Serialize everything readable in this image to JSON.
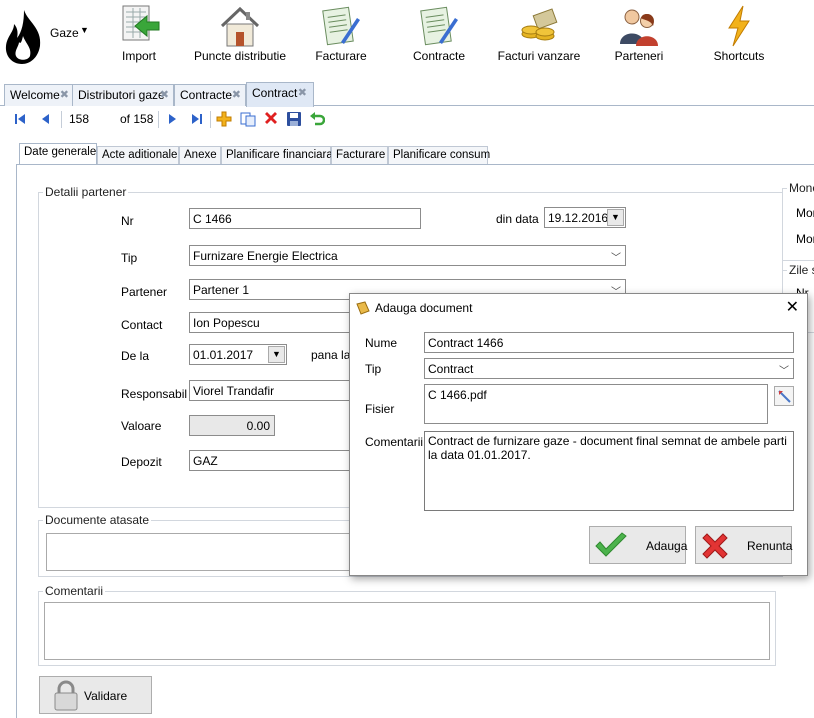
{
  "app": {
    "title": "Gaze"
  },
  "ribbon": [
    {
      "name": "import-button",
      "icon": "import-icon",
      "label": "Import"
    },
    {
      "name": "puncte-distributie-button",
      "icon": "house-icon",
      "label": "Puncte distributie"
    },
    {
      "name": "facturare-button",
      "icon": "invoice-icon",
      "label": "Facturare"
    },
    {
      "name": "contracte-button",
      "icon": "contract-icon",
      "label": "Contracte"
    },
    {
      "name": "facturi-vanzare-button",
      "icon": "coins-icon",
      "label": "Facturi vanzare"
    },
    {
      "name": "parteneri-button",
      "icon": "people-icon",
      "label": "Parteneri"
    },
    {
      "name": "shortcuts-button",
      "icon": "lightning-icon",
      "label": "Shortcuts"
    }
  ],
  "doc_tabs": [
    "Welcome",
    "Distributori gaze",
    "Contracte",
    "Contract"
  ],
  "navigator": {
    "current": "158",
    "of_total": "of 158"
  },
  "inner_tabs": [
    "Date generale",
    "Acte aditionale",
    "Anexe",
    "Planificare financiara",
    "Facturare",
    "Planificare consum"
  ],
  "detalii": {
    "legend": "Detalii partener",
    "nr_label": "Nr",
    "nr_value": "C 1466",
    "din_data_label": "din data",
    "din_data_value": "19.12.2016",
    "tip_label": "Tip",
    "tip_value": "Furnizare Energie Electrica",
    "partener_label": "Partener",
    "partener_value": "Partener 1",
    "contact_label": "Contact",
    "contact_value": "Ion Popescu",
    "de_la_label": "De la",
    "de_la_value": "01.01.2017",
    "pana_la_label": "pana la",
    "responsabil_label": "Responsabil",
    "responsabil_value": "Viorel Trandafir",
    "valoare_label": "Valoare",
    "valoare_value": "0.00",
    "depozit_label": "Depozit",
    "depozit_value": "GAZ"
  },
  "right_panel": {
    "group1_legend": "Mone",
    "row1": "Mon",
    "row2": "Mon",
    "group2_legend": "Zile s",
    "row3": "Nr"
  },
  "documente": {
    "legend": "Documente atasate"
  },
  "comentarii": {
    "legend": "Comentarii"
  },
  "validare_label": "Validare",
  "dialog": {
    "title": "Adauga document",
    "nume_label": "Nume",
    "nume_value": "Contract 1466",
    "tip_label": "Tip",
    "tip_value": "Contract",
    "fisier_label": "Fisier",
    "fisier_value": "C 1466.pdf",
    "comentarii_label": "Comentarii",
    "comentarii_value": "Contract de furnizare gaze - document final semnat de ambele parti la data 01.01.2017.",
    "adauga_label": "Adauga",
    "renunta_label": "Renunta"
  }
}
